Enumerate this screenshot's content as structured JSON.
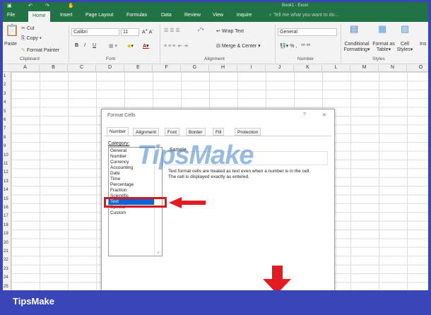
{
  "window_title": "Book1 - Excel",
  "tabs": [
    "File",
    "Home",
    "Insert",
    "Page Layout",
    "Formulas",
    "Data",
    "Review",
    "View",
    "Inquire"
  ],
  "tell_me": "Tell me what you want to do...",
  "clipboard": {
    "paste": "Paste",
    "cut": "Cut",
    "copy": "Copy",
    "format_painter": "Format Painter",
    "label": "Clipboard"
  },
  "font": {
    "name": "Calibri",
    "size": "11",
    "bold": "B",
    "italic": "I",
    "underline": "U",
    "label": "Font"
  },
  "alignment": {
    "wrap": "Wrap Text",
    "merge": "Merge & Center",
    "label": "Alignment"
  },
  "number": {
    "format": "General",
    "percent": "%",
    "comma": ",",
    "label": "Number"
  },
  "styles": {
    "conditional": "Conditional",
    "formatting": "Formatting",
    "format_as": "Format as",
    "table": "Table",
    "cell": "Cell",
    "cell_styles": "Styles",
    "label": "Styles",
    "insert": "Ins"
  },
  "columns": [
    "A",
    "B",
    "C",
    "D",
    "E",
    "F",
    "G",
    "H",
    "I",
    "J",
    "K",
    "L",
    "M",
    "N",
    "O"
  ],
  "rows": [
    "1",
    "2",
    "3",
    "4",
    "5",
    "6",
    "7",
    "8",
    "9",
    "10",
    "11",
    "12",
    "13",
    "14",
    "15",
    "16",
    "17",
    "18",
    "19",
    "20",
    "21",
    "22",
    "23",
    "24",
    "25"
  ],
  "dialog": {
    "title": "Format Cells",
    "help": "?",
    "close": "✕",
    "tabs": [
      "Number",
      "Alignment",
      "Font",
      "Border",
      "Fill",
      "Protection"
    ],
    "category_label": "Category:",
    "categories": [
      "General",
      "Number",
      "Currency",
      "Accounting",
      "Date",
      "Time",
      "Percentage",
      "Fraction",
      "Scientific",
      "Text",
      "Special",
      "Custom"
    ],
    "selected": "Text",
    "sample_label": "Sample",
    "description1": "Text format cells are treated as text even when a number is in the cell.",
    "description2": "The cell is displayed exactly as entered."
  },
  "watermark": "TipsMake",
  "brand": "TipsMake",
  "colors": {
    "excel_green": "#217346",
    "banner": "#3a45b8",
    "highlight": "#e31b23"
  }
}
